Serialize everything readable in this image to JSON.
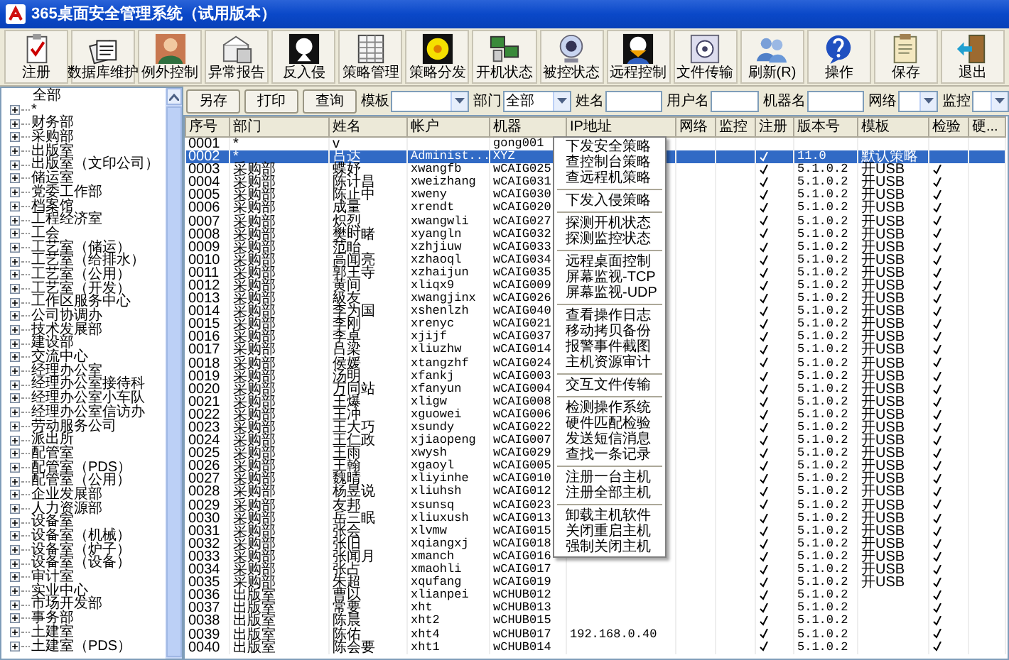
{
  "window": {
    "title": "365桌面安全管理系统（试用版本）"
  },
  "toolbar": [
    "注册",
    "数据库维护",
    "例外控制",
    "异常报告",
    "反入侵",
    "策略管理",
    "策略分发",
    "开机状态",
    "被控状态",
    "远程控制",
    "文件传输",
    "刷新(R)",
    "操作",
    "保存",
    "退出"
  ],
  "tree": {
    "label": "全部",
    "children": [
      {
        "label": "*",
        "expanded": false
      },
      {
        "label": "财务部",
        "expanded": false
      },
      {
        "label": "采购部",
        "expanded": false
      },
      {
        "label": "出版室",
        "expanded": false
      },
      {
        "label": "出版室（文印公司）",
        "expanded": false
      },
      {
        "label": "储运室",
        "expanded": false
      },
      {
        "label": "党委工作部",
        "expanded": false
      },
      {
        "label": "档案馆",
        "expanded": false
      },
      {
        "label": "工程经济室",
        "expanded": false
      },
      {
        "label": "工会",
        "expanded": false
      },
      {
        "label": "工艺室（储运）",
        "expanded": false
      },
      {
        "label": "工艺室（给排水）",
        "expanded": false
      },
      {
        "label": "工艺室（公用）",
        "expanded": false
      },
      {
        "label": "工艺室（开发）",
        "expanded": false
      },
      {
        "label": "工作区服务中心",
        "expanded": false
      },
      {
        "label": "公司协调办",
        "expanded": false
      },
      {
        "label": "技术发展部",
        "expanded": false
      },
      {
        "label": "建设部",
        "expanded": false
      },
      {
        "label": "交流中心",
        "expanded": false
      },
      {
        "label": "经理办公室",
        "expanded": false
      },
      {
        "label": "经理办公室接待科",
        "expanded": false
      },
      {
        "label": "经理办公室小车队",
        "expanded": false
      },
      {
        "label": "经理办公室信访办",
        "expanded": false
      },
      {
        "label": "劳动服务公司",
        "expanded": false
      },
      {
        "label": "派出所",
        "expanded": false
      },
      {
        "label": "配管室",
        "expanded": false
      },
      {
        "label": "配管室（PDS）",
        "expanded": false
      },
      {
        "label": "配管室（公用）",
        "expanded": false
      },
      {
        "label": "企业发展部",
        "expanded": false
      },
      {
        "label": "人力资源部",
        "expanded": false
      },
      {
        "label": "设备室",
        "expanded": false
      },
      {
        "label": "设备室（机械）",
        "expanded": false
      },
      {
        "label": "设备室（炉子）",
        "expanded": false
      },
      {
        "label": "设备室（设备）",
        "expanded": false
      },
      {
        "label": "审计室",
        "expanded": false
      },
      {
        "label": "实业中心",
        "expanded": false
      },
      {
        "label": "市场开发部",
        "expanded": false
      },
      {
        "label": "事务部",
        "expanded": false
      },
      {
        "label": "土建室",
        "expanded": false
      },
      {
        "label": "土建室（PDS）",
        "expanded": false
      }
    ]
  },
  "actions": [
    "另存",
    "打印",
    "查询"
  ],
  "filters": [
    {
      "kind": "combo",
      "label": "模板"
    },
    {
      "kind": "combo",
      "label": "部门",
      "value": "全部"
    },
    {
      "kind": "text",
      "label": "姓名"
    },
    {
      "kind": "text",
      "label": "用户名"
    },
    {
      "kind": "text",
      "label": "机器名"
    },
    {
      "kind": "combo",
      "label": "网络"
    },
    {
      "kind": "combo",
      "label": "监控"
    }
  ],
  "table": {
    "columns": [
      "序号",
      "部门",
      "姓名",
      "帐户",
      "机器",
      "IP地址",
      "网络",
      "监控",
      "注册",
      "版本号",
      "模板",
      "检验",
      "硬..."
    ],
    "rows": [
      {
        "no": "0001",
        "dept": "*",
        "name": "v",
        "machine": "gong001",
        "registered": false,
        "verified": false,
        "selected": false
      },
      {
        "no": "0002",
        "dept": "*",
        "name": "吕达",
        "account": "Administ...",
        "machine": "XYZ",
        "registered": true,
        "version": "11.0",
        "template": "默认策略",
        "verified": false,
        "selected": true
      },
      {
        "no": "0003",
        "dept": "采购部",
        "name": "蝶妤",
        "account": "xwangfb",
        "machine": "wCAIG025",
        "registered": true,
        "version": "5.1.0.2",
        "template": "开USB",
        "verified": true,
        "selected": false
      },
      {
        "no": "0004",
        "dept": "采购部",
        "name": "陈计昌",
        "account": "xweizhang",
        "machine": "wCAIG031",
        "registered": true,
        "version": "5.1.0.2",
        "template": "开USB",
        "verified": true,
        "selected": false
      },
      {
        "no": "0005",
        "dept": "采购部",
        "name": "陈止中",
        "account": "xweny",
        "machine": "wCAIG030",
        "registered": true,
        "version": "5.1.0.2",
        "template": "开USB",
        "verified": true,
        "selected": false
      },
      {
        "no": "0006",
        "dept": "采购部",
        "name": "成量",
        "account": "xrendt",
        "machine": "wCAIG020",
        "registered": true,
        "version": "5.1.0.2",
        "template": "开USB",
        "verified": true,
        "selected": false
      },
      {
        "no": "0007",
        "dept": "采购部",
        "name": "炽烈",
        "account": "xwangwli",
        "machine": "wCAIG027",
        "registered": true,
        "version": "5.1.0.2",
        "template": "开USB",
        "verified": true,
        "selected": false
      },
      {
        "no": "0008",
        "dept": "采购部",
        "name": "樊时睹",
        "account": "xyangln",
        "machine": "wCAIG032",
        "registered": true,
        "version": "5.1.0.2",
        "template": "开USB",
        "verified": true,
        "selected": false
      },
      {
        "no": "0009",
        "dept": "采购部",
        "name": "范眙",
        "account": "xzhjiuw",
        "machine": "wCAIG033",
        "registered": true,
        "version": "5.1.0.2",
        "template": "开USB",
        "verified": true,
        "selected": false
      },
      {
        "no": "0010",
        "dept": "采购部",
        "name": "高闻亮",
        "account": "xzhaoql",
        "machine": "wCAIG034",
        "registered": true,
        "version": "5.1.0.2",
        "template": "开USB",
        "verified": true,
        "selected": false
      },
      {
        "no": "0011",
        "dept": "采购部",
        "name": "郭王寺",
        "account": "xzhaijun",
        "machine": "wCAIG035",
        "registered": true,
        "version": "5.1.0.2",
        "template": "开USB",
        "verified": true,
        "selected": false
      },
      {
        "no": "0012",
        "dept": "采购部",
        "name": "黄间",
        "account": "xliqx9",
        "machine": "wCAIG009",
        "registered": true,
        "version": "5.1.0.2",
        "template": "开USB",
        "verified": true,
        "selected": false
      },
      {
        "no": "0013",
        "dept": "采购部",
        "name": "級友",
        "account": "xwangjinx",
        "machine": "wCAIG026",
        "registered": true,
        "version": "5.1.0.2",
        "template": "开USB",
        "verified": true,
        "selected": false
      },
      {
        "no": "0014",
        "dept": "采购部",
        "name": "李为国",
        "account": "xshenlzh",
        "machine": "wCAIG040",
        "registered": true,
        "version": "5.1.0.2",
        "template": "开USB",
        "verified": true,
        "selected": false
      },
      {
        "no": "0015",
        "dept": "采购部",
        "name": "李刚",
        "account": "xrenyc",
        "machine": "wCAIG021",
        "registered": true,
        "version": "5.1.0.2",
        "template": "开USB",
        "verified": true,
        "selected": false
      },
      {
        "no": "0016",
        "dept": "采购部",
        "name": "李卓",
        "account": "xjijf",
        "machine": "wCAIG037",
        "registered": true,
        "version": "5.1.0.2",
        "template": "开USB",
        "verified": true,
        "selected": false
      },
      {
        "no": "0017",
        "dept": "采购部",
        "name": "吕梁",
        "account": "xliuzhw",
        "machine": "wCAIG014",
        "registered": true,
        "version": "5.1.0.2",
        "template": "开USB",
        "verified": true,
        "selected": false
      },
      {
        "no": "0018",
        "dept": "采购部",
        "name": "侯媛",
        "account": "xtangzhf",
        "machine": "wCAIG024",
        "registered": true,
        "version": "5.1.0.2",
        "template": "开USB",
        "verified": true,
        "selected": false
      },
      {
        "no": "0019",
        "dept": "采购部",
        "name": "汤明",
        "account": "xfankj",
        "machine": "wCAIG003",
        "registered": true,
        "version": "5.1.0.2",
        "template": "开USB",
        "verified": true,
        "selected": false
      },
      {
        "no": "0020",
        "dept": "采购部",
        "name": "万同站",
        "account": "xfanyun",
        "machine": "wCAIG004",
        "registered": true,
        "version": "5.1.0.2",
        "template": "开USB",
        "verified": true,
        "selected": false
      },
      {
        "no": "0021",
        "dept": "采购部",
        "name": "王爆",
        "account": "xligw",
        "machine": "wCAIG008",
        "registered": true,
        "version": "5.1.0.2",
        "template": "开USB",
        "verified": true,
        "selected": false
      },
      {
        "no": "0022",
        "dept": "采购部",
        "name": "王冲",
        "account": "xguowei",
        "machine": "wCAIG006",
        "registered": true,
        "version": "5.1.0.2",
        "template": "开USB",
        "verified": true,
        "selected": false
      },
      {
        "no": "0023",
        "dept": "采购部",
        "name": "王大巧",
        "account": "xsundy",
        "machine": "wCAIG022",
        "registered": true,
        "version": "5.1.0.2",
        "template": "开USB",
        "verified": true,
        "selected": false
      },
      {
        "no": "0024",
        "dept": "采购部",
        "name": "王仁政",
        "account": "xjiaopeng",
        "machine": "wCAIG007",
        "registered": true,
        "version": "5.1.0.2",
        "template": "开USB",
        "verified": true,
        "selected": false
      },
      {
        "no": "0025",
        "dept": "采购部",
        "name": "王雨",
        "account": "xwysh",
        "machine": "wCAIG029",
        "registered": true,
        "version": "5.1.0.2",
        "template": "开USB",
        "verified": true,
        "selected": false
      },
      {
        "no": "0026",
        "dept": "采购部",
        "name": "王翰",
        "account": "xgaoyl",
        "machine": "wCAIG005",
        "registered": true,
        "version": "5.1.0.2",
        "template": "开USB",
        "verified": true,
        "selected": false
      },
      {
        "no": "0027",
        "dept": "采购部",
        "name": "魏晴",
        "account": "xliyinhe",
        "machine": "wCAIG010",
        "registered": true,
        "version": "5.1.0.2",
        "template": "开USB",
        "verified": true,
        "selected": false
      },
      {
        "no": "0028",
        "dept": "采购部",
        "name": "杨昱说",
        "account": "xliuhsh",
        "machine": "wCAIG012",
        "registered": true,
        "version": "5.1.0.2",
        "template": "开USB",
        "verified": true,
        "selected": false
      },
      {
        "no": "0029",
        "dept": "采购部",
        "name": "友邦",
        "account": "xsunsq",
        "machine": "wCAIG023",
        "registered": true,
        "version": "5.1.0.2",
        "template": "开USB",
        "verified": true,
        "selected": false
      },
      {
        "no": "0030",
        "dept": "采购部",
        "name": "岳三眠",
        "account": "xliuxush",
        "machine": "wCAIG013",
        "registered": true,
        "version": "5.1.0.2",
        "template": "开USB",
        "verified": true,
        "selected": false
      },
      {
        "no": "0031",
        "dept": "采购部",
        "name": "张会",
        "account": "xlvmw",
        "machine": "wCAIG015",
        "registered": true,
        "version": "5.1.0.2",
        "template": "开USB",
        "verified": true,
        "selected": false
      },
      {
        "no": "0032",
        "dept": "采购部",
        "name": "张旧",
        "account": "xqiangxj",
        "machine": "wCAIG018",
        "registered": true,
        "version": "5.1.0.2",
        "template": "开USB",
        "verified": true,
        "selected": false
      },
      {
        "no": "0033",
        "dept": "采购部",
        "name": "张闻月",
        "account": "xmanch",
        "machine": "wCAIG016",
        "registered": true,
        "version": "5.1.0.2",
        "template": "开USB",
        "verified": true,
        "selected": false
      },
      {
        "no": "0034",
        "dept": "采购部",
        "name": "张占",
        "account": "xmaohli",
        "machine": "wCAIG017",
        "registered": true,
        "version": "5.1.0.2",
        "template": "开USB",
        "verified": true,
        "selected": false
      },
      {
        "no": "0035",
        "dept": "采购部",
        "name": "朱超",
        "account": "xqufang",
        "machine": "wCAIG019",
        "registered": true,
        "version": "5.1.0.2",
        "template": "开USB",
        "verified": true,
        "selected": false
      },
      {
        "no": "0036",
        "dept": "出版室",
        "name": "曹以",
        "account": "xlianpei",
        "machine": "wCHUB012",
        "registered": true,
        "version": "5.1.0.2",
        "verified": true,
        "selected": false
      },
      {
        "no": "0037",
        "dept": "出版室",
        "name": "常要",
        "account": "xht",
        "machine": "wCHUB013",
        "registered": true,
        "version": "5.1.0.2",
        "verified": true,
        "selected": false
      },
      {
        "no": "0038",
        "dept": "出版室",
        "name": "陈晨",
        "account": "xht2",
        "machine": "wCHUB015",
        "registered": true,
        "version": "5.1.0.2",
        "verified": true,
        "selected": false
      },
      {
        "no": "0039",
        "dept": "出版室",
        "name": "陈佑",
        "account": "xht4",
        "machine": "wCHUB017",
        "ip": "192.168.0.40",
        "registered": true,
        "version": "5.1.0.2",
        "verified": true,
        "selected": false
      },
      {
        "no": "0040",
        "dept": "出版室",
        "name": "陈会要",
        "account": "xht1",
        "machine": "wCHUB014",
        "registered": true,
        "version": "5.1.0.2",
        "verified": true,
        "selected": false
      }
    ]
  },
  "context_menu": {
    "groups": [
      [
        "下发安全策略",
        "查控制台策略",
        "查远程机策略"
      ],
      [
        "下发入侵策略"
      ],
      [
        "探测开机状态",
        "探测监控状态"
      ],
      [
        "远程桌面控制",
        "屏幕监视-TCP",
        "屏幕监视-UDP"
      ],
      [
        "查看操作日志",
        "移动拷贝备份",
        "报警事件截图",
        "主机资源审计"
      ],
      [
        "交互文件传输"
      ],
      [
        "检测操作系统",
        "硬件匹配检验",
        "发送短信消息",
        "查找一条记录"
      ],
      [
        "注册一台主机",
        "注册全部主机"
      ],
      [
        "卸载主机软件",
        "关闭重启主机",
        "强制关闭主机"
      ]
    ]
  }
}
